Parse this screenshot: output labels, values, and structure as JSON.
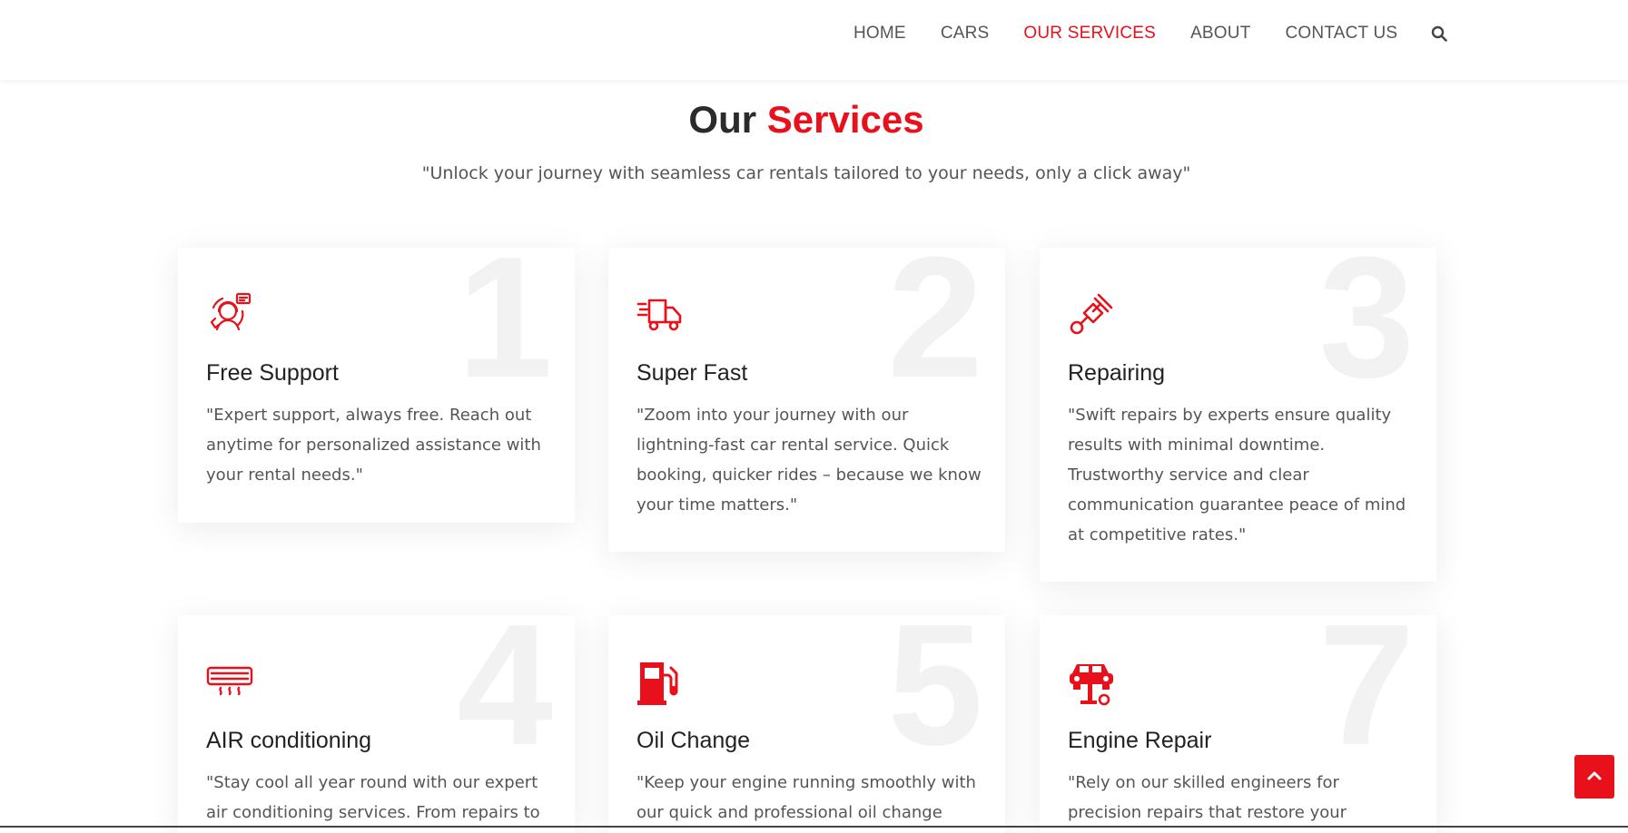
{
  "nav": {
    "items": [
      {
        "label": "HOME",
        "active": false
      },
      {
        "label": "CARS",
        "active": false
      },
      {
        "label": "OUR SERVICES",
        "active": true
      },
      {
        "label": "ABOUT",
        "active": false
      },
      {
        "label": "CONTACT US",
        "active": false
      }
    ],
    "search_icon": "search-icon"
  },
  "section": {
    "title_main": "Our",
    "title_accent": "Services",
    "subtitle": "\"Unlock your journey with seamless car rentals tailored to your needs, only a click away\""
  },
  "cards": [
    {
      "number": "1",
      "icon": "support-agent-icon",
      "title": "Free Support",
      "text": "\"Expert support, always free. Reach out anytime for personalized assistance with your rental needs.\""
    },
    {
      "number": "2",
      "icon": "fast-truck-icon",
      "title": "Super Fast",
      "text": "\"Zoom into your journey with our lightning-fast car rental service. Quick booking, quicker rides – because we know your time matters.\""
    },
    {
      "number": "3",
      "icon": "spark-plug-icon",
      "title": "Repairing",
      "text": "\"Swift repairs by experts ensure quality results with minimal downtime. Trustworthy service and clear communication guarantee peace of mind at competitive rates.\""
    },
    {
      "number": "4",
      "icon": "air-conditioner-icon",
      "title": "AIR conditioning",
      "text": "\"Stay cool all year round with our expert air conditioning services. From repairs to"
    },
    {
      "number": "5",
      "icon": "fuel-pump-icon",
      "title": "Oil Change",
      "text": "\"Keep your engine running smoothly with our quick and professional oil change"
    },
    {
      "number": "7",
      "icon": "car-lift-icon",
      "title": "Engine Repair",
      "text": "\"Rely on our skilled engineers for precision repairs that restore your vehicle's"
    }
  ],
  "colors": {
    "accent": "#e8101a",
    "text": "#555555",
    "heading": "#2b2b2b"
  },
  "back_to_top_icon": "chevron-up-icon"
}
